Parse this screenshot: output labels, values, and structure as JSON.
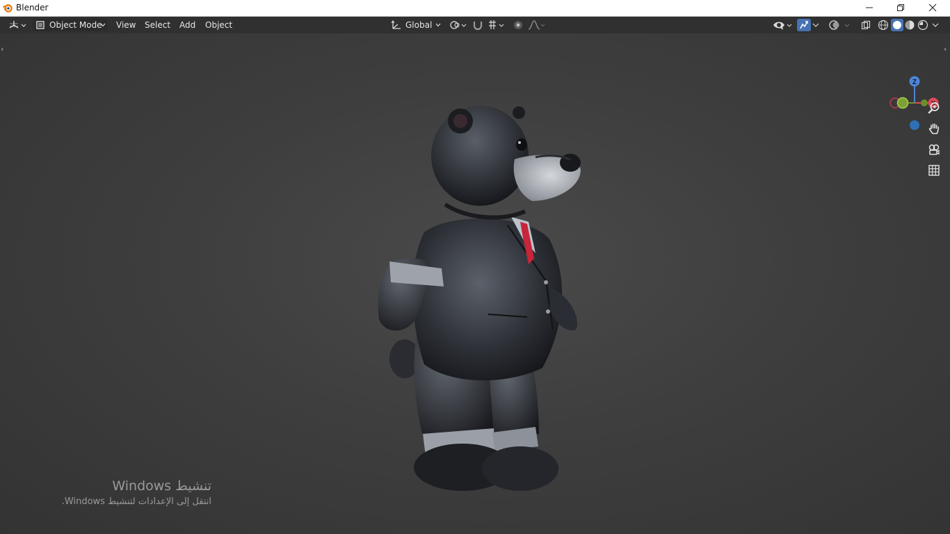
{
  "window": {
    "title": "Blender",
    "icons": {
      "logo": "blender-logo",
      "minimize": "minimize-icon",
      "restore": "restore-icon",
      "close": "close-icon"
    }
  },
  "header": {
    "editor_type_icon": "view3d-icon",
    "mode": "Object Mode",
    "menus": [
      "View",
      "Select",
      "Add",
      "Object"
    ],
    "transform_orientation": "Global",
    "accent_color": "#4772b3"
  },
  "viewport": {
    "gizmo_axes": [
      "Z",
      "X"
    ],
    "nav_tools": [
      "zoom-icon",
      "pan-hand-icon",
      "camera-view-icon",
      "ortho-grid-icon"
    ],
    "object": "teddy bear in suit"
  },
  "watermark": {
    "title": "تنشيط Windows",
    "subtitle": "انتقل إلى الإعدادات لتنشيط Windows."
  }
}
